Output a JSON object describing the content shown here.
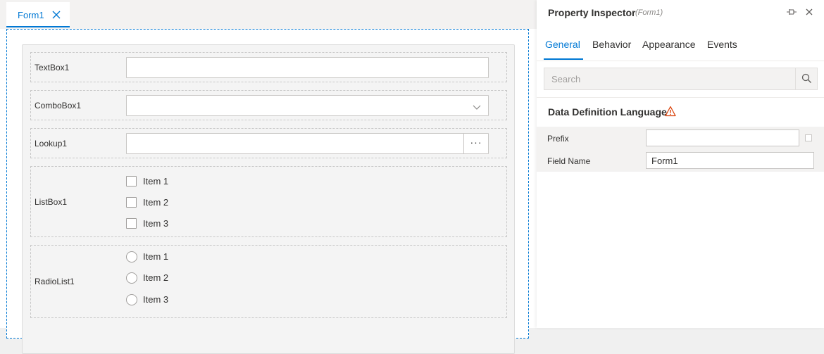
{
  "document_tab": {
    "label": "Form1"
  },
  "form": {
    "textbox": {
      "label": "TextBox1"
    },
    "combobox": {
      "label": "ComboBox1"
    },
    "lookup": {
      "label": "Lookup1",
      "button_label": "···"
    },
    "listbox": {
      "label": "ListBox1",
      "items": [
        "Item 1",
        "Item 2",
        "Item 3"
      ]
    },
    "radiolist": {
      "label": "RadioList1",
      "items": [
        "Item 1",
        "Item 2",
        "Item 3"
      ]
    }
  },
  "inspector": {
    "title": "Property Inspector",
    "subtitle": "(Form1)",
    "tabs": [
      {
        "label": "General",
        "active": true
      },
      {
        "label": "Behavior",
        "active": false
      },
      {
        "label": "Appearance",
        "active": false
      },
      {
        "label": "Events",
        "active": false
      }
    ],
    "search": {
      "placeholder": "Search",
      "value": ""
    },
    "section": {
      "title": "Data Definition Language"
    },
    "properties": {
      "prefix": {
        "label": "Prefix",
        "value": ""
      },
      "field_name": {
        "label": "Field Name",
        "value": "Form1"
      }
    }
  },
  "colors": {
    "accent": "#0078d4",
    "warning": "#d83b01",
    "panel_background": "#f4f4f4"
  },
  "icons": [
    "close-icon",
    "chevron-down-icon",
    "ellipsis-icon",
    "pin-icon",
    "search-icon",
    "warning-icon"
  ]
}
